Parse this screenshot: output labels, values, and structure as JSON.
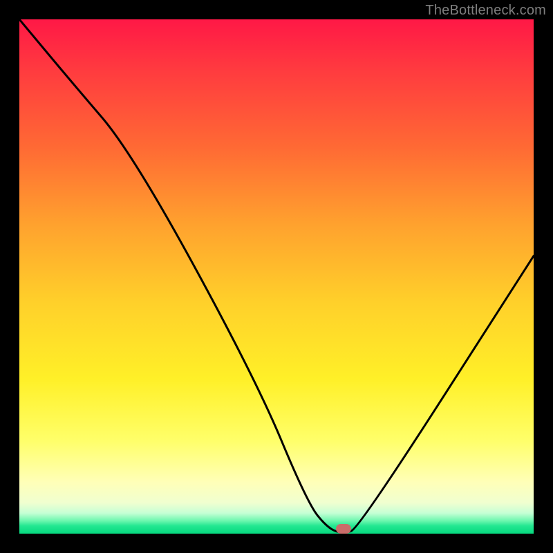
{
  "watermark": "TheBottleneck.com",
  "marker": {
    "x_pct": 63,
    "y_pct": 99
  },
  "chart_data": {
    "type": "line",
    "title": "",
    "xlabel": "",
    "ylabel": "",
    "xlim": [
      0,
      100
    ],
    "ylim": [
      0,
      100
    ],
    "grid": false,
    "series": [
      {
        "name": "bottleneck-curve",
        "x": [
          0,
          10,
          22,
          46,
          56,
          60,
          63,
          66,
          100
        ],
        "y": [
          100,
          88,
          74,
          30,
          6,
          1,
          0,
          1,
          54
        ]
      }
    ],
    "annotations": [
      {
        "name": "optimal-marker",
        "x": 63,
        "y": 0
      }
    ],
    "background_gradient": {
      "top": "#ff1846",
      "mid": "#fff028",
      "bottom": "#06d97f"
    }
  }
}
